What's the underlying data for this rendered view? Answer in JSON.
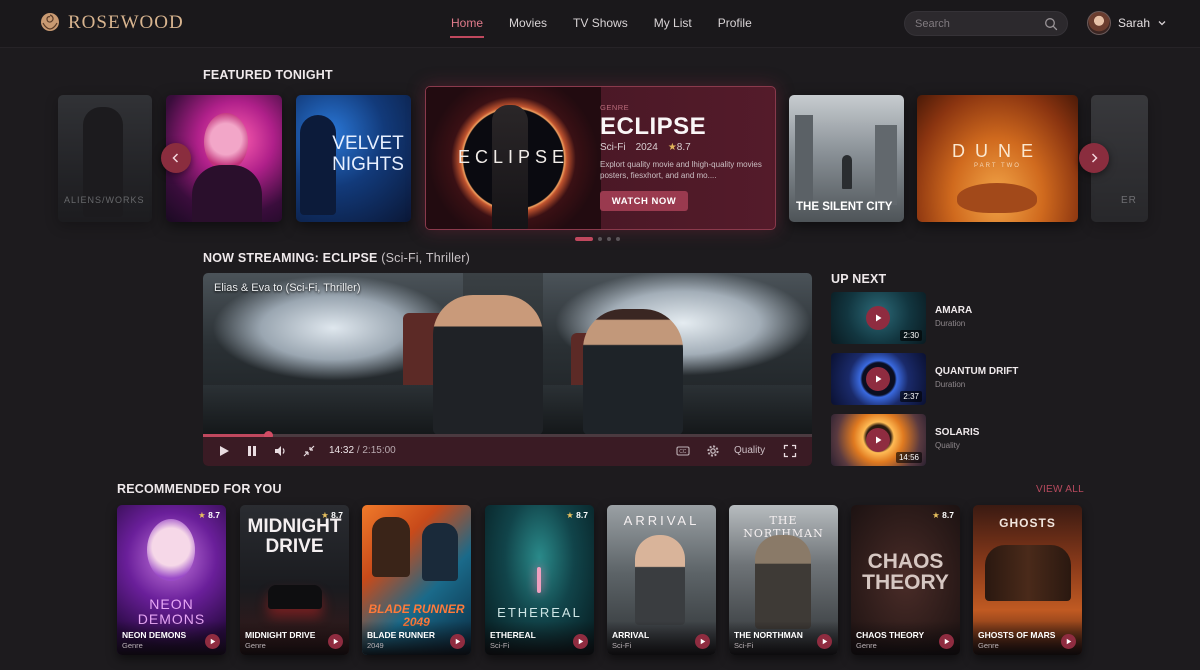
{
  "app": {
    "brand": "ROSEWOOD"
  },
  "nav": {
    "items": [
      "Home",
      "Movies",
      "TV Shows",
      "My List",
      "Profile"
    ],
    "active": "Home"
  },
  "search": {
    "placeholder": "Search"
  },
  "user": {
    "name": "Sarah"
  },
  "featured": {
    "section_title": "FEATURED TONIGHT",
    "side_posters": [
      "ALIENS/WORKS",
      "",
      "VELVET NIGHTS",
      "THE SILENT CITY",
      "DUNE",
      "ER"
    ],
    "velvet_title": "VELVET NIGHTS",
    "silent_city_title": "THE SILENT CITY",
    "dune_title": "DUNE",
    "dune_sub": "PART TWO",
    "faded_left_text": "ALIENS/WORKS",
    "faded_right_text": "ER",
    "card": {
      "art_title": "ECLIPSE",
      "genre_label": "GENRE",
      "title": "ECLIPSE",
      "genre": "Sci-Fi",
      "year": "2024",
      "rating": "8.7",
      "description": "Explort quality movie and lhigh-quality movies posters, fiesxhort, and and mo....",
      "cta": "WATCH NOW"
    },
    "dots": 4,
    "active_dot": 0
  },
  "now_streaming": {
    "prefix": "NOW STREAMING:",
    "title": "ECLIPSE",
    "genres": "(Sci-Fi, Thriller)",
    "caption": "Elias & Eva to (Sci-Fi, Thriller)",
    "time_current": "14:32",
    "time_total": "/ 2:15:00",
    "progress": 0.107,
    "quality_label": "Quality"
  },
  "up_next": {
    "title": "UP NEXT",
    "items": [
      {
        "title": "AMARA",
        "sub": "Duration",
        "duration": "2:30"
      },
      {
        "title": "QUANTUM DRIFT",
        "sub": "Duration",
        "duration": "2:37"
      },
      {
        "title": "SOLARIS",
        "sub": "Quality",
        "duration": "14:56"
      }
    ]
  },
  "recommended": {
    "title": "RECOMMENDED FOR YOU",
    "view_all": "VIEW ALL",
    "items": [
      {
        "title": "NEON DEMONS",
        "sub": "Genre",
        "rating": "8.7",
        "art": "NEON DEMONS"
      },
      {
        "title": "MIDNIGHT DRIVE",
        "sub": "Genre",
        "rating": "8.7",
        "art": "MIDNIGHT DRIVE"
      },
      {
        "title": "BLADE RUNNER",
        "sub": "2049",
        "rating": "",
        "art": "BLADE RUNNER 2049"
      },
      {
        "title": "ETHEREAL",
        "sub": "Sci-Fi",
        "rating": "8.7",
        "art": "ETHEREAL"
      },
      {
        "title": "ARRIVAL",
        "sub": "Sci-Fi",
        "rating": "",
        "art": "ARRIVAL"
      },
      {
        "title": "THE NORTHMAN",
        "sub": "Sci-Fi",
        "rating": "",
        "art": "THE NORTHMAN"
      },
      {
        "title": "CHAOS THEORY",
        "sub": "Genre",
        "rating": "8.7",
        "art": "CHAOS THEORY"
      },
      {
        "title": "GHOSTS OF MARS",
        "sub": "Genre",
        "rating": "",
        "art": "GHOSTS"
      }
    ]
  },
  "colors": {
    "accent": "#c0485e",
    "brand": "#d8b48f",
    "background": "#1d1b1e"
  }
}
